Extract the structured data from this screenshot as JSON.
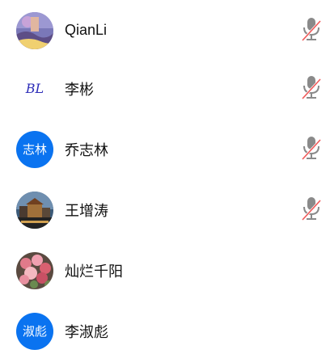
{
  "participants": [
    {
      "name": "QianLi",
      "avatar_type": "photo",
      "avatar_icon": "landscape-photo-icon",
      "mic_muted": true
    },
    {
      "name": "李彬",
      "avatar_type": "script",
      "avatar_text": "BL",
      "mic_muted": true
    },
    {
      "name": "乔志林",
      "avatar_type": "initials",
      "avatar_text": "志林",
      "mic_muted": true
    },
    {
      "name": "王增涛",
      "avatar_type": "photo",
      "avatar_icon": "building-photo-icon",
      "mic_muted": true
    },
    {
      "name": "灿烂千阳",
      "avatar_type": "photo",
      "avatar_icon": "flowers-photo-icon",
      "mic_muted": false
    },
    {
      "name": "李淑彪",
      "avatar_type": "initials",
      "avatar_text": "淑彪",
      "mic_muted": false
    }
  ],
  "colors": {
    "initials_bg": "#0a73f0",
    "mic_gray": "#8a8a8a",
    "mute_slash": "#f05a5a"
  }
}
